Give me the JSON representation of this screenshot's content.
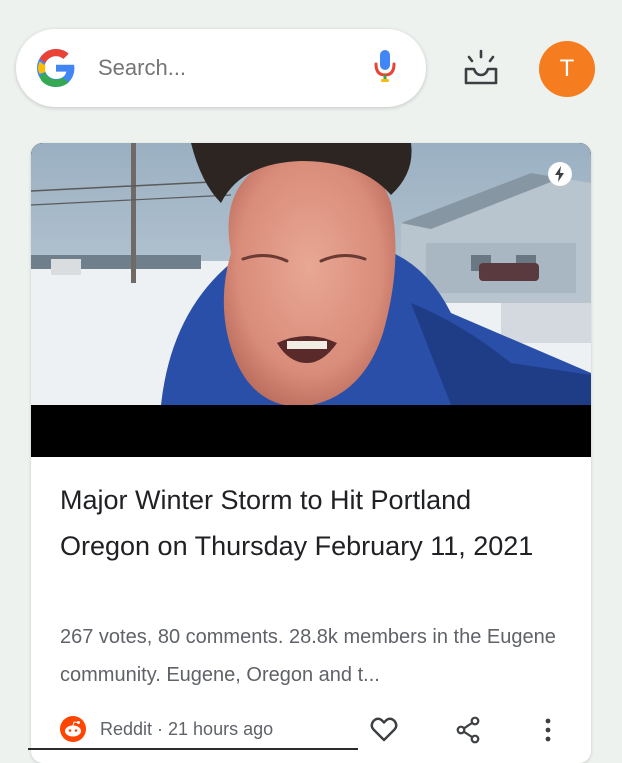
{
  "search": {
    "placeholder": "Search..."
  },
  "account": {
    "initial": "T",
    "avatar_color": "#f57c1f"
  },
  "icons": {
    "logo": "google-g-icon",
    "mic": "mic-icon",
    "discover": "sparkle-inbox-icon",
    "amp": "lightning-icon",
    "source": "reddit-icon",
    "like": "heart-icon",
    "share": "share-icon",
    "more": "more-vert-icon"
  },
  "card": {
    "title": "Major Winter Storm to Hit Portland Oregon on Thursday February 11, 2021",
    "snippet": "267 votes, 80 comments. 28.8k members in the Eugene community. Eugene, Oregon and t...",
    "source": "Reddit",
    "time": "21 hours ago",
    "meta": "Reddit · 21 hours ago"
  },
  "colors": {
    "background": "#eef2ef",
    "accent_orange": "#f57c1f",
    "text_primary": "#202124",
    "text_secondary": "#5f6368"
  }
}
